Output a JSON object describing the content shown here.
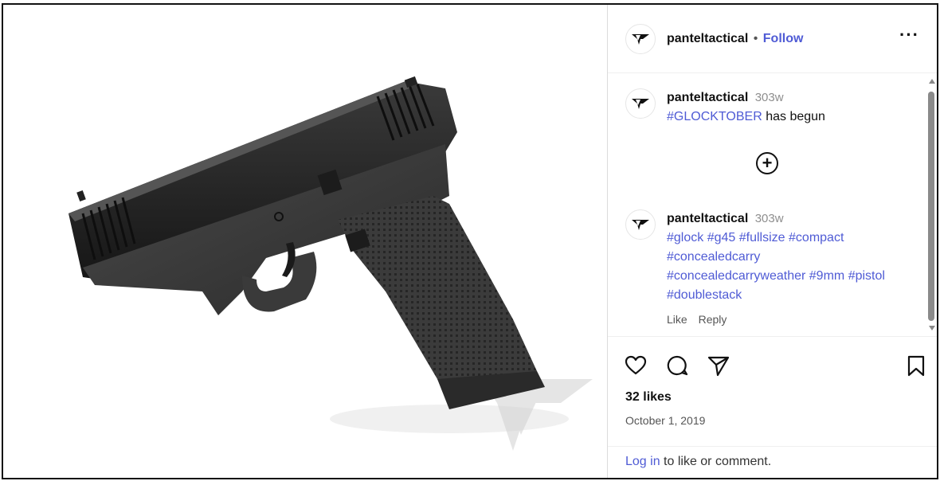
{
  "post": {
    "username": "panteltactical",
    "separator": "•",
    "follow_label": "Follow",
    "more_label": "···"
  },
  "comments": [
    {
      "username": "panteltactical",
      "time": "303w",
      "tags": [
        "#GLOCKTOBER"
      ],
      "text": "has begun"
    },
    {
      "username": "panteltactical",
      "time": "303w",
      "lines": [
        [
          "#glock",
          "#g45",
          "#fullsize",
          "#compact"
        ],
        [
          "#concealedcarry"
        ],
        [
          "#concealedcarryweather",
          "#9mm",
          "#pistol"
        ],
        [
          "#doublestack"
        ]
      ],
      "like_label": "Like",
      "reply_label": "Reply"
    }
  ],
  "load_more_label": "+",
  "stats": {
    "likes": "32 likes",
    "date": "October 1, 2019"
  },
  "login": {
    "link": "Log in",
    "text": " to like or comment."
  },
  "icons": {
    "like": "heart-icon",
    "comment": "comment-icon",
    "share": "paper-plane-icon",
    "save": "bookmark-icon",
    "logo": "pantel-logo-icon"
  },
  "colors": {
    "link": "#4f5bd5",
    "muted": "#8e8e8e",
    "border": "#dbdbdb"
  }
}
